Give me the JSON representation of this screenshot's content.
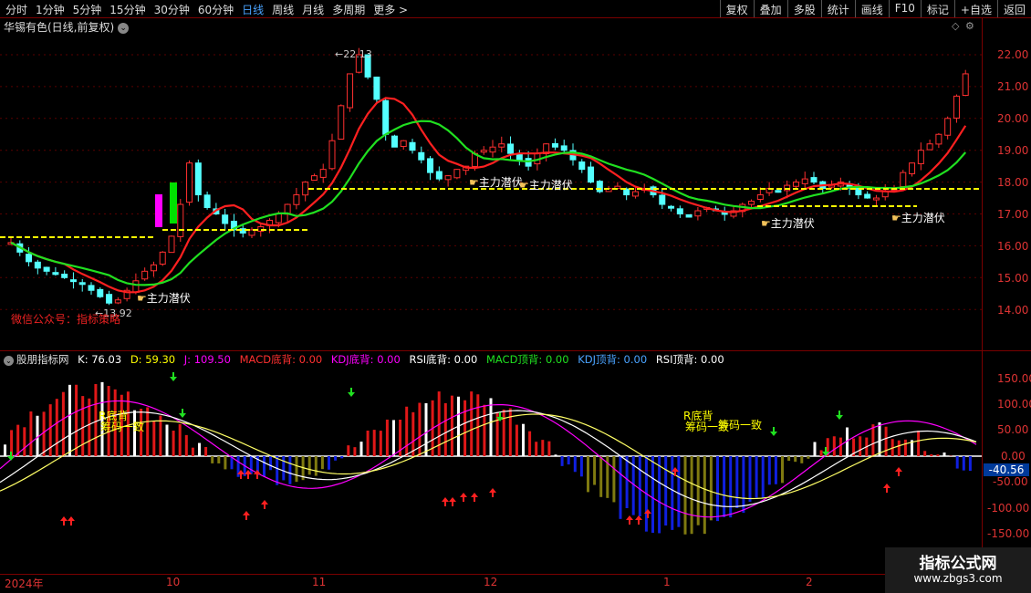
{
  "toolbar": {
    "periods": [
      "分时",
      "1分钟",
      "5分钟",
      "15分钟",
      "30分钟",
      "60分钟",
      "日线",
      "周线",
      "月线",
      "多周期",
      "更多 >"
    ],
    "active_index": 6,
    "right": [
      "复权",
      "叠加",
      "多股",
      "统计",
      "画线",
      "F10",
      "标记",
      "+自选",
      "返回"
    ]
  },
  "chart": {
    "title": "华锡有色(日线,前复权)",
    "price_ticks": [
      "22.00",
      "21.00",
      "20.00",
      "19.00",
      "18.00",
      "17.00",
      "16.00",
      "15.00",
      "14.00"
    ],
    "high_label": "22.13",
    "low_label": "13.92",
    "wechat_text": "微信公众号：指标策略",
    "callouts": [
      "主力潜伏",
      "主力潜伏",
      "主力潜伏",
      "主力潜伏",
      "主力潜伏"
    ]
  },
  "indicator": {
    "name": "股朋指标网",
    "k": "K: 76.03",
    "d": "D: 59.30",
    "j": "J: 109.50",
    "macd_bottom": "MACD底背: 0.00",
    "kdj_bottom": "KDJ底背: 0.00",
    "rsi_bottom": "RSI底背: 0.00",
    "macd_top": "MACD顶背: 0.00",
    "kdj_top": "KDJ顶背: 0.00",
    "rsi_top": "RSI顶背: 0.00",
    "ticks": [
      "150.00",
      "100.00",
      "50.00",
      "0.00",
      "-50.00",
      "-100.00",
      "-150.00"
    ],
    "current_value": "-40.56",
    "labels": [
      "R底背",
      "筹码一致",
      "R底背",
      "筹码一致",
      "筹码一致"
    ]
  },
  "dates": [
    "2024年",
    "10",
    "11",
    "12",
    "1",
    "2"
  ],
  "watermark": {
    "title": "指标公式网",
    "url": "www.zbgs3.com"
  },
  "colors": {
    "up": "#ff3030",
    "down": "#54ffff",
    "ma_fast": "#ff2020",
    "ma_slow": "#20e020",
    "support": "#ffff00"
  }
}
